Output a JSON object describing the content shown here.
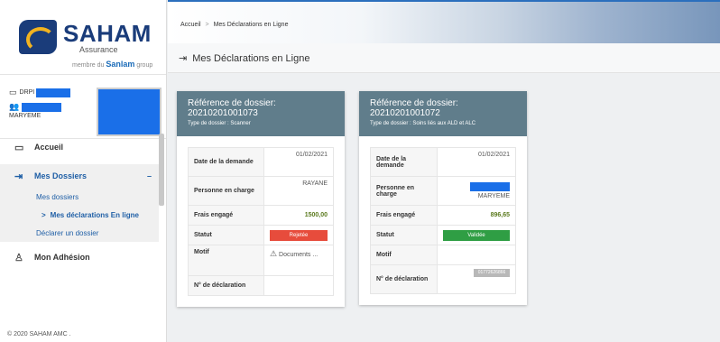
{
  "brand": {
    "name": "SAHAM",
    "sub": "Assurance",
    "tag_prefix": "membre du",
    "tag_brand": "Sanlam",
    "tag_suffix": "group"
  },
  "user": {
    "line1": "DRPI",
    "name": "MARYEME"
  },
  "nav": {
    "accueil": "Accueil",
    "mes_dossiers": "Mes Dossiers",
    "collapse": "–",
    "sub_mes_dossiers": "Mes dossiers",
    "sub_arrow": ">",
    "sub_mes_declarations": "Mes déclarations En ligne",
    "sub_declarer": "Déclarer un dossier",
    "adhesion": "Mon Adhésion"
  },
  "footer": "© 2020 SAHAM AMC .",
  "breadcrumb": {
    "home": "Accueil",
    "sep": ">",
    "current": "Mes Déclarations en Ligne"
  },
  "page_title": "Mes Déclarations en Ligne",
  "cards": [
    {
      "ref_label": "Référence de dossier:",
      "ref": "20210201001073",
      "type": "Type de dossier : Scanner",
      "date_label": "Date de la demande",
      "date": "01/02/2021",
      "personne_label": "Personne en charge",
      "personne": "RAYANE",
      "frais_label": "Frais engagé",
      "frais": "1500,00",
      "statut_label": "Statut",
      "statut": "Rejetée",
      "motif_label": "Motif",
      "motif": "Documents ...",
      "num_label": "N° de déclaration",
      "num": ""
    },
    {
      "ref_label": "Référence de dossier:",
      "ref": "20210201001072",
      "type": "Type de dossier : Soins liés aux ALD et ALC",
      "date_label": "Date de la demande",
      "date": "01/02/2021",
      "personne_label": "Personne en charge",
      "personne": "MARYEME",
      "frais_label": "Frais engagé",
      "frais": "896,65",
      "statut_label": "Statut",
      "statut": "Validée",
      "motif_label": "Motif",
      "motif": "",
      "num_label": "N° de déclaration",
      "num": "01772626866"
    }
  ],
  "colors": {
    "card_header": "#607d8b",
    "rejected": "#e74c3c",
    "validated": "#2f9e44",
    "brand_blue": "#1a3c7a",
    "link_blue": "#1f5fa6"
  }
}
